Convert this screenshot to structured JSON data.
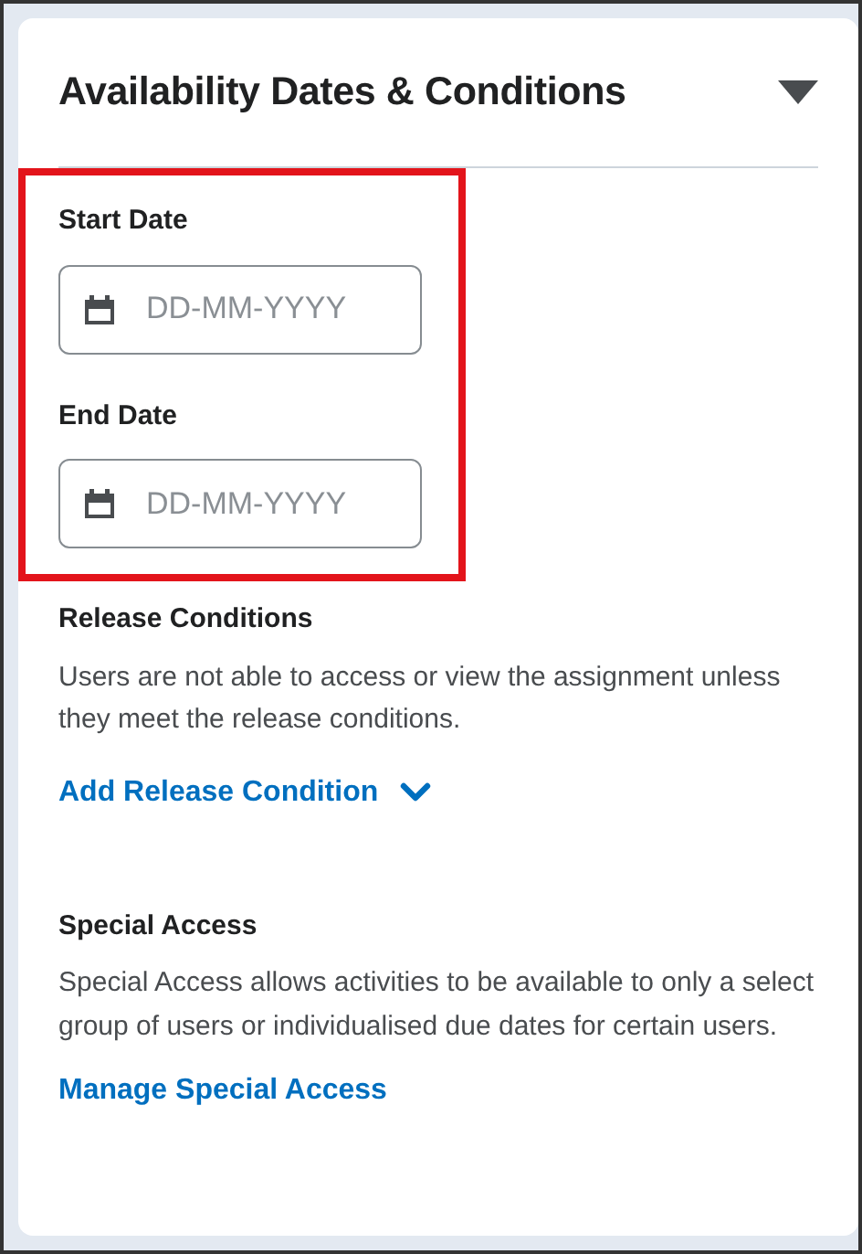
{
  "section": {
    "title": "Availability Dates & Conditions",
    "expanded": true
  },
  "dates": {
    "highlighted": true,
    "fields": [
      {
        "label": "Start Date",
        "placeholder": "DD-MM-YYYY"
      },
      {
        "label": "End Date",
        "placeholder": "DD-MM-YYYY"
      }
    ]
  },
  "release_conditions": {
    "heading": "Release Conditions",
    "description": "Users are not able to access or view the assignment unless they meet the release conditions.",
    "link": "Add Release Condition"
  },
  "special_access": {
    "heading": "Special Access",
    "description": "Special Access allows activities to be available to only a select group of users or individualised due dates for certain users.",
    "link": "Manage Special Access"
  }
}
